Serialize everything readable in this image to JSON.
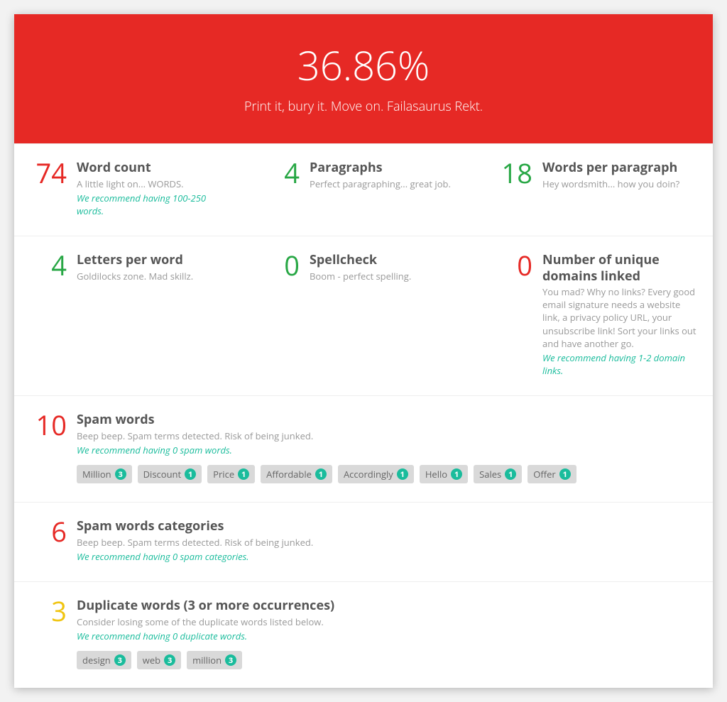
{
  "header": {
    "score": "36.86%",
    "tagline": "Print it, bury it. Move on. Failasaurus Rekt."
  },
  "metrics": {
    "word_count": {
      "value": "74",
      "color": "red",
      "title": "Word count",
      "desc": "A little light on... WORDS.",
      "reco": "We recommend having 100-250 words."
    },
    "paragraphs": {
      "value": "4",
      "color": "green",
      "title": "Paragraphs",
      "desc": "Perfect paragraphing... great job.",
      "reco": ""
    },
    "wpp": {
      "value": "18",
      "color": "green",
      "title": "Words per paragraph",
      "desc": "Hey wordsmith... how you doin?",
      "reco": ""
    },
    "lpw": {
      "value": "4",
      "color": "green",
      "title": "Letters per word",
      "desc": "Goldilocks zone. Mad skillz.",
      "reco": ""
    },
    "spell": {
      "value": "0",
      "color": "green",
      "title": "Spellcheck",
      "desc": "Boom - perfect spelling.",
      "reco": ""
    },
    "domains": {
      "value": "0",
      "color": "red",
      "title": "Number of unique domains linked",
      "desc": "You mad? Why no links? Every good email signature needs a website link, a privacy policy URL, your unsubscribe link! Sort your links out and have another go.",
      "reco": "We recommend having 1-2 domain links."
    }
  },
  "spam": {
    "value": "10",
    "color": "red",
    "title": "Spam words",
    "desc": "Beep beep. Spam terms detected. Risk of being junked.",
    "reco": "We recommend having 0 spam words.",
    "items": [
      {
        "word": "Million",
        "count": "3"
      },
      {
        "word": "Discount",
        "count": "1"
      },
      {
        "word": "Price",
        "count": "1"
      },
      {
        "word": "Affordable",
        "count": "1"
      },
      {
        "word": "Accordingly",
        "count": "1"
      },
      {
        "word": "Hello",
        "count": "1"
      },
      {
        "word": "Sales",
        "count": "1"
      },
      {
        "word": "Offer",
        "count": "1"
      }
    ]
  },
  "spam_cat": {
    "value": "6",
    "color": "red",
    "title": "Spam words categories",
    "desc": "Beep beep. Spam terms detected. Risk of being junked.",
    "reco": "We recommend having 0 spam categories."
  },
  "dupes": {
    "value": "3",
    "color": "amber",
    "title": "Duplicate words (3 or more occurrences)",
    "desc": "Consider losing some of the duplicate words listed below.",
    "reco": "We recommend having 0 duplicate words.",
    "items": [
      {
        "word": "design",
        "count": "3"
      },
      {
        "word": "web",
        "count": "3"
      },
      {
        "word": "million",
        "count": "3"
      }
    ]
  }
}
